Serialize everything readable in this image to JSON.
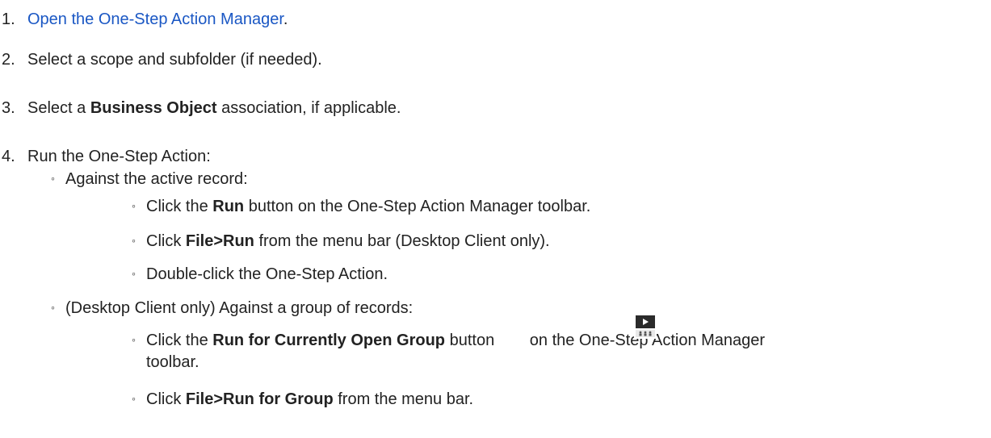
{
  "steps": [
    {
      "num": "1.",
      "link_text": "Open the One-Step Action Manager",
      "after": "."
    },
    {
      "num": "2.",
      "text": "Select a scope and subfolder (if needed)."
    },
    {
      "num": "3.",
      "before": "Select a ",
      "bold": "Business Object",
      "after": " association, if applicable."
    },
    {
      "num": "4.",
      "text": "Run the One-Step Action:"
    }
  ],
  "active": {
    "label": "Against the active record:",
    "items": [
      {
        "before": "Click the ",
        "bold": "Run",
        "after": " button on the One-Step Action Manager toolbar."
      },
      {
        "before": "Click ",
        "bold": "File>Run",
        "after": " from the menu bar (Desktop Client only)."
      },
      {
        "text": "Double-click the One-Step Action."
      }
    ]
  },
  "group": {
    "label": "(Desktop Client only) Against a group of records:",
    "items": [
      {
        "before": "Click the ",
        "bold": "Run for Currently Open Group",
        "after": " button",
        "after2": " on the One-Step Action Manager",
        "cont": "toolbar."
      },
      {
        "before": "Click ",
        "bold": "File>Run for Group",
        "after": " from the menu bar."
      }
    ]
  },
  "bullet": "◦"
}
